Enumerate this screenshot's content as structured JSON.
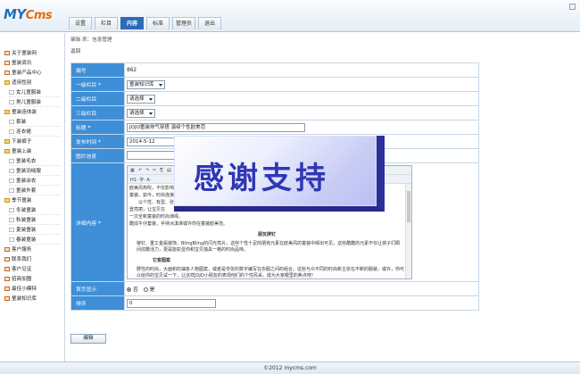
{
  "header": {
    "logo_main": "MY",
    "logo_cms": "Cms",
    "tabs": [
      "设置",
      "栏目",
      "内容",
      "标准",
      "管理员",
      "退出"
    ],
    "active_tab": 2
  },
  "sidebar": {
    "items": [
      {
        "label": "关于童装网",
        "kind": "top"
      },
      {
        "label": "童装资讯",
        "kind": "top"
      },
      {
        "label": "童装产品中心",
        "kind": "top"
      },
      {
        "label": "适用性别",
        "kind": "folder"
      },
      {
        "label": "女儿童服装",
        "kind": "sub"
      },
      {
        "label": "男儿童服装",
        "kind": "sub"
      },
      {
        "label": "童装连体装",
        "kind": "folder"
      },
      {
        "label": "套装",
        "kind": "sub"
      },
      {
        "label": "连衣裙",
        "kind": "sub"
      },
      {
        "label": "下装裤子",
        "kind": "folder"
      },
      {
        "label": "童装上装",
        "kind": "folder"
      },
      {
        "label": "童装毛衣",
        "kind": "sub"
      },
      {
        "label": "童装羽绒服",
        "kind": "sub"
      },
      {
        "label": "童装泳衣",
        "kind": "sub"
      },
      {
        "label": "童装外套",
        "kind": "sub"
      },
      {
        "label": "季节童装",
        "kind": "folder"
      },
      {
        "label": "冬装童装",
        "kind": "sub"
      },
      {
        "label": "秋装童装",
        "kind": "sub"
      },
      {
        "label": "夏装童装",
        "kind": "sub"
      },
      {
        "label": "春装童装",
        "kind": "sub"
      },
      {
        "label": "客户服务",
        "kind": "top"
      },
      {
        "label": "联系我们",
        "kind": "top"
      },
      {
        "label": "客户见证",
        "kind": "top"
      },
      {
        "label": "招商加盟",
        "kind": "top"
      },
      {
        "label": "最佳小模特",
        "kind": "top"
      },
      {
        "label": "童装知识库",
        "kind": "top"
      }
    ]
  },
  "main": {
    "breadcrumb": "编辑 表：信息管理",
    "back_link": "返回",
    "fields": {
      "id_label": "编号",
      "id_value": "862",
      "cat1_label": "一级栏目",
      "cat1_value": "童装知识库",
      "cat2_label": "二级栏目",
      "cat2_value": "请选择",
      "cat3_label": "三级栏目",
      "cat3_value": "请选择",
      "title_label": "标题",
      "title_value": "JOJO童装帅气穿搭 演绎个性欧美范",
      "date_label": "发布时间",
      "date_value": "2014-5-12",
      "image_label": "图片信息",
      "content_label": "详细内容",
      "home_label": "首页显示",
      "home_yes": "否",
      "home_no": "是",
      "order_label": "排序",
      "order_value": "0"
    },
    "required_mark": "*",
    "editor": {
      "toolbar_row2": "H1· 字· A·",
      "lines": [
        "欧美风热吹，不仅影响",
        "童装。如今，时尚连接",
        "以个性、有型、张扬",
        "登亮丽，让宝贝在 ",
        "一次全新童装的时尚演绎。",
        "酷炫牛仔套装，手持冰淇淋或许你在童装欧美范。"
      ],
      "heading1": "朋友牌钉",
      "para1": "铆钉、重工金属装饰、BlingBling的闪光亮片，这些个性十足的朋克元素在欧美风的童装中频出可见，这些酷酷的元素不仅让孩子们瞬间炫酷活力，更是能彰显你和宝贝独具一格的时尚品味。",
      "heading2": "它客图案",
      "para2": "野性的时尚，大面积的抽象人物图案，或者是夸张的数字编写在衣服之间的组合，这些与众不同的时尚新主张在不断的服装，或许，你可以给你的宝贝试一下，让这样JOJO小朋友的表现他们的个性风采，成为大家眼里的焦点吧！"
    },
    "submit_label": "编辑"
  },
  "watermark": "感谢支持",
  "footer": "©2012 mycms.com"
}
